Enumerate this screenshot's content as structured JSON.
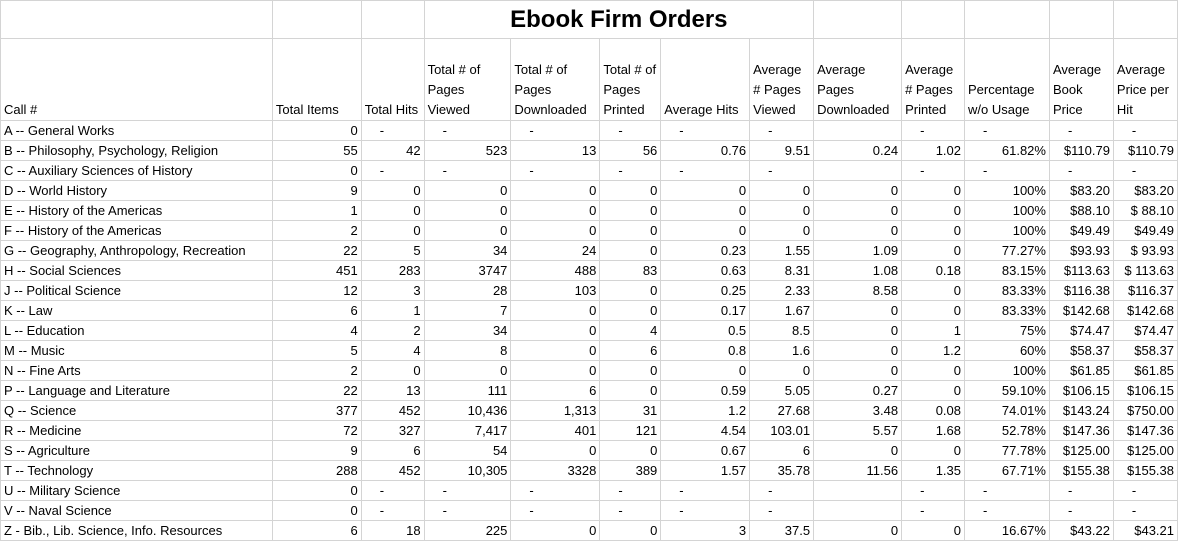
{
  "title": "Ebook Firm Orders",
  "headers": [
    "Call #",
    "Total Items",
    "Total Hits",
    "Total # of Pages Viewed",
    "Total # of Pages Downloaded",
    "Total # of Pages Printed",
    "Average Hits",
    "Average # Pages Viewed",
    "Average Pages Downloaded",
    "Average # Pages Printed",
    "Percentage w/o Usage",
    "Average Book Price",
    "Average Price per Hit"
  ],
  "rows": [
    [
      "A -- General Works",
      "0",
      "-",
      "-",
      "-",
      "-",
      "-",
      "-",
      "",
      "-",
      "-",
      "-",
      "-"
    ],
    [
      "B -- Philosophy, Psychology, Religion",
      "55",
      "42",
      "523",
      "13",
      "56",
      "0.76",
      "9.51",
      "0.24",
      "1.02",
      "61.82%",
      "$110.79",
      "$110.79"
    ],
    [
      "C -- Auxiliary Sciences of History",
      "0",
      "-",
      "-",
      "-",
      "-",
      "-",
      "-",
      "",
      "-",
      "-",
      "-",
      "-"
    ],
    [
      "D -- World History",
      "9",
      "0",
      "0",
      "0",
      "0",
      "0",
      "0",
      "0",
      "0",
      "100%",
      "$83.20",
      "$83.20"
    ],
    [
      "E -- History of the Americas",
      "1",
      "0",
      "0",
      "0",
      "0",
      "0",
      "0",
      "0",
      "0",
      "100%",
      "$88.10",
      "$ 88.10"
    ],
    [
      "F -- History of the Americas",
      "2",
      "0",
      "0",
      "0",
      "0",
      "0",
      "0",
      "0",
      "0",
      "100%",
      "$49.49",
      "$49.49"
    ],
    [
      "G -- Geography, Anthropology, Recreation",
      "22",
      "5",
      "34",
      "24",
      "0",
      "0.23",
      "1.55",
      "1.09",
      "0",
      "77.27%",
      "$93.93",
      "$ 93.93"
    ],
    [
      "H -- Social Sciences",
      "451",
      "283",
      "3747",
      "488",
      "83",
      "0.63",
      "8.31",
      "1.08",
      "0.18",
      "83.15%",
      "$113.63",
      "$ 113.63"
    ],
    [
      "J -- Political Science",
      "12",
      "3",
      "28",
      "103",
      "0",
      "0.25",
      "2.33",
      "8.58",
      "0",
      "83.33%",
      "$116.38",
      "$116.37"
    ],
    [
      "K -- Law",
      "6",
      "1",
      "7",
      "0",
      "0",
      "0.17",
      "1.67",
      "0",
      "0",
      "83.33%",
      "$142.68",
      "$142.68"
    ],
    [
      "L -- Education",
      "4",
      "2",
      "34",
      "0",
      "4",
      "0.5",
      "8.5",
      "0",
      "1",
      "75%",
      "$74.47",
      "$74.47"
    ],
    [
      "M -- Music",
      "5",
      "4",
      "8",
      "0",
      "6",
      "0.8",
      "1.6",
      "0",
      "1.2",
      "60%",
      "$58.37",
      "$58.37"
    ],
    [
      "N -- Fine Arts",
      "2",
      "0",
      "0",
      "0",
      "0",
      "0",
      "0",
      "0",
      "0",
      "100%",
      "$61.85",
      "$61.85"
    ],
    [
      "P -- Language and Literature",
      "22",
      "13",
      "111",
      "6",
      "0",
      "0.59",
      "5.05",
      "0.27",
      "0",
      "59.10%",
      "$106.15",
      "$106.15"
    ],
    [
      "Q -- Science",
      "377",
      "452",
      "10,436",
      "1,313",
      "31",
      "1.2",
      "27.68",
      "3.48",
      "0.08",
      "74.01%",
      "$143.24",
      "$750.00"
    ],
    [
      "R -- Medicine",
      "72",
      "327",
      "7,417",
      "401",
      "121",
      "4.54",
      "103.01",
      "5.57",
      "1.68",
      "52.78%",
      "$147.36",
      "$147.36"
    ],
    [
      "S -- Agriculture",
      "9",
      "6",
      "54",
      "0",
      "0",
      "0.67",
      "6",
      "0",
      "0",
      "77.78%",
      "$125.00",
      "$125.00"
    ],
    [
      "T -- Technology",
      "288",
      "452",
      "10,305",
      "3328",
      "389",
      "1.57",
      "35.78",
      "11.56",
      "1.35",
      "67.71%",
      "$155.38",
      "$155.38"
    ],
    [
      "U -- Military Science",
      "0",
      "-",
      "-",
      "-",
      "-",
      "-",
      "-",
      "",
      "-",
      "-",
      "-",
      "-"
    ],
    [
      "V -- Naval Science",
      "0",
      "-",
      "-",
      "-",
      "-",
      "-",
      "-",
      "",
      "-",
      "-",
      "-",
      "-"
    ],
    [
      "Z - Bib., Lib. Science, Info. Resources",
      "6",
      "18",
      "225",
      "0",
      "0",
      "3",
      "37.5",
      "0",
      "0",
      "16.67%",
      "$43.22",
      "$43.21"
    ]
  ]
}
